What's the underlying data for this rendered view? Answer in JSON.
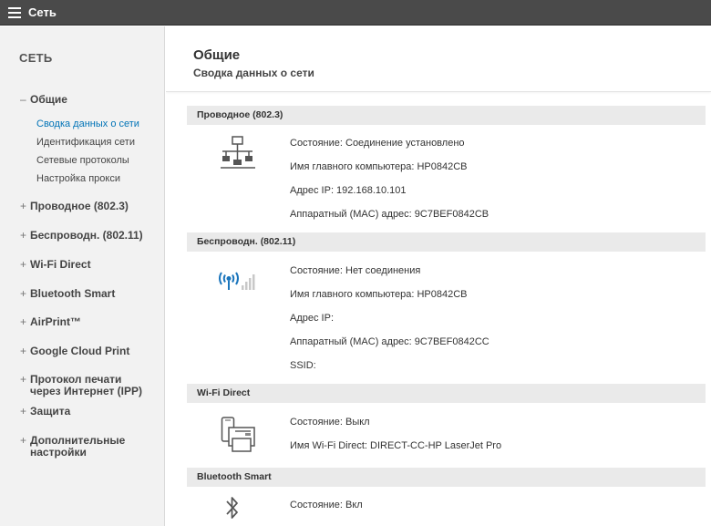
{
  "window": {
    "title": "Сеть"
  },
  "sidebar": {
    "heading": "СЕТЬ",
    "expanded": {
      "sign": "–",
      "label": "Общие",
      "items": [
        "Сводка данных о сети",
        "Идентификация сети",
        "Сетевые протоколы",
        "Настройка прокси"
      ]
    },
    "collapsed_sign": "+",
    "groups": [
      "Проводное (802.3)",
      "Беспроводн. (802.11)",
      "Wi-Fi Direct",
      "Bluetooth Smart",
      "AirPrint™",
      "Google Cloud Print",
      "Протокол печати через Интернет (IPP)",
      "Защита",
      "Дополнительные настройки"
    ]
  },
  "main": {
    "title": "Общие",
    "subtitle": "Сводка данных о сети",
    "sections": [
      {
        "header": "Проводное (802.3)",
        "icon": "wired-network-icon",
        "rows": [
          "Состояние: Соединение установлено",
          "Имя главного компьютера: HP0842CB",
          "Адрес IP: 192.168.10.101",
          "Аппаратный (MAC) адрес: 9C7BEF0842CB"
        ]
      },
      {
        "header": "Беспроводн. (802.11)",
        "icon": "wireless-signal-icon",
        "rows": [
          "Состояние: Нет соединения",
          "Имя главного компьютера: HP0842CB",
          "Адрес IP:",
          "Аппаратный (MAC) адрес: 9C7BEF0842CC",
          "SSID:"
        ]
      },
      {
        "header": "Wi-Fi Direct",
        "icon": "wifi-direct-icon",
        "rows": [
          "Состояние: Выкл",
          "Имя Wi-Fi Direct: DIRECT-CC-HP LaserJet Pro"
        ]
      },
      {
        "header": "Bluetooth Smart",
        "icon": "bluetooth-icon",
        "rows": [
          "Состояние: Вкл"
        ]
      }
    ]
  },
  "colors": {
    "topbar": "#4a4a4a",
    "accent": "#0073b7",
    "wireless_blue": "#1a75bc",
    "sidebar_bg": "#f2f2f2"
  }
}
